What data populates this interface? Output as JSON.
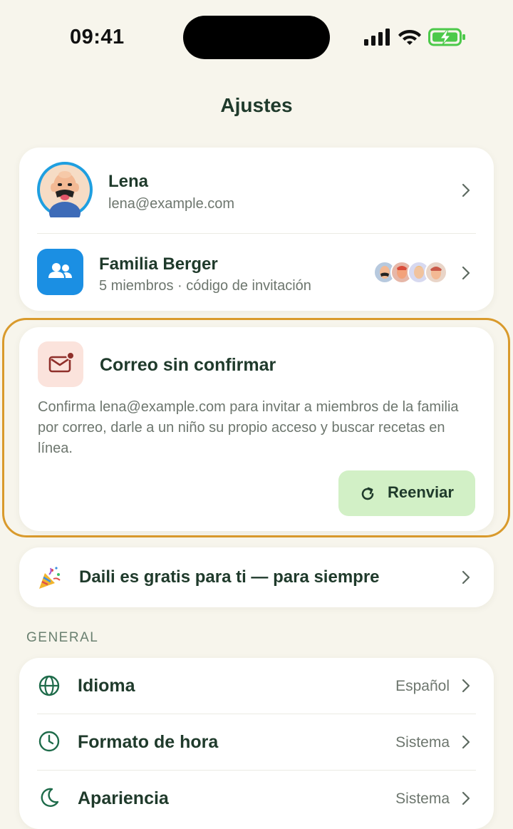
{
  "status_bar": {
    "time": "09:41"
  },
  "header": {
    "title": "Ajustes"
  },
  "profile": {
    "name": "Lena",
    "email": "lena@example.com"
  },
  "family": {
    "name": "Familia Berger",
    "subtitle": "5 miembros · código de invitación"
  },
  "email_notice": {
    "title": "Correo sin confirmar",
    "body": "Confirma lena@example.com para invitar a miembros de la familia por correo, darle a un niño su propio acceso y buscar recetas en línea.",
    "button_label": "Reenviar"
  },
  "free_banner": {
    "text": "Daili es gratis para ti — para siempre"
  },
  "general": {
    "section_label": "GENERAL",
    "items": [
      {
        "label": "Idioma",
        "value": "Español",
        "icon": "globe-icon"
      },
      {
        "label": "Formato de hora",
        "value": "Sistema",
        "icon": "clock-icon"
      },
      {
        "label": "Apariencia",
        "value": "Sistema",
        "icon": "moon-icon"
      }
    ]
  },
  "colors": {
    "background": "#f7f5ec",
    "accent_green": "#1e6b4a",
    "highlight_border": "#d99a2c",
    "button_bg": "#d2f0c6",
    "family_blue": "#1b8fe3"
  }
}
